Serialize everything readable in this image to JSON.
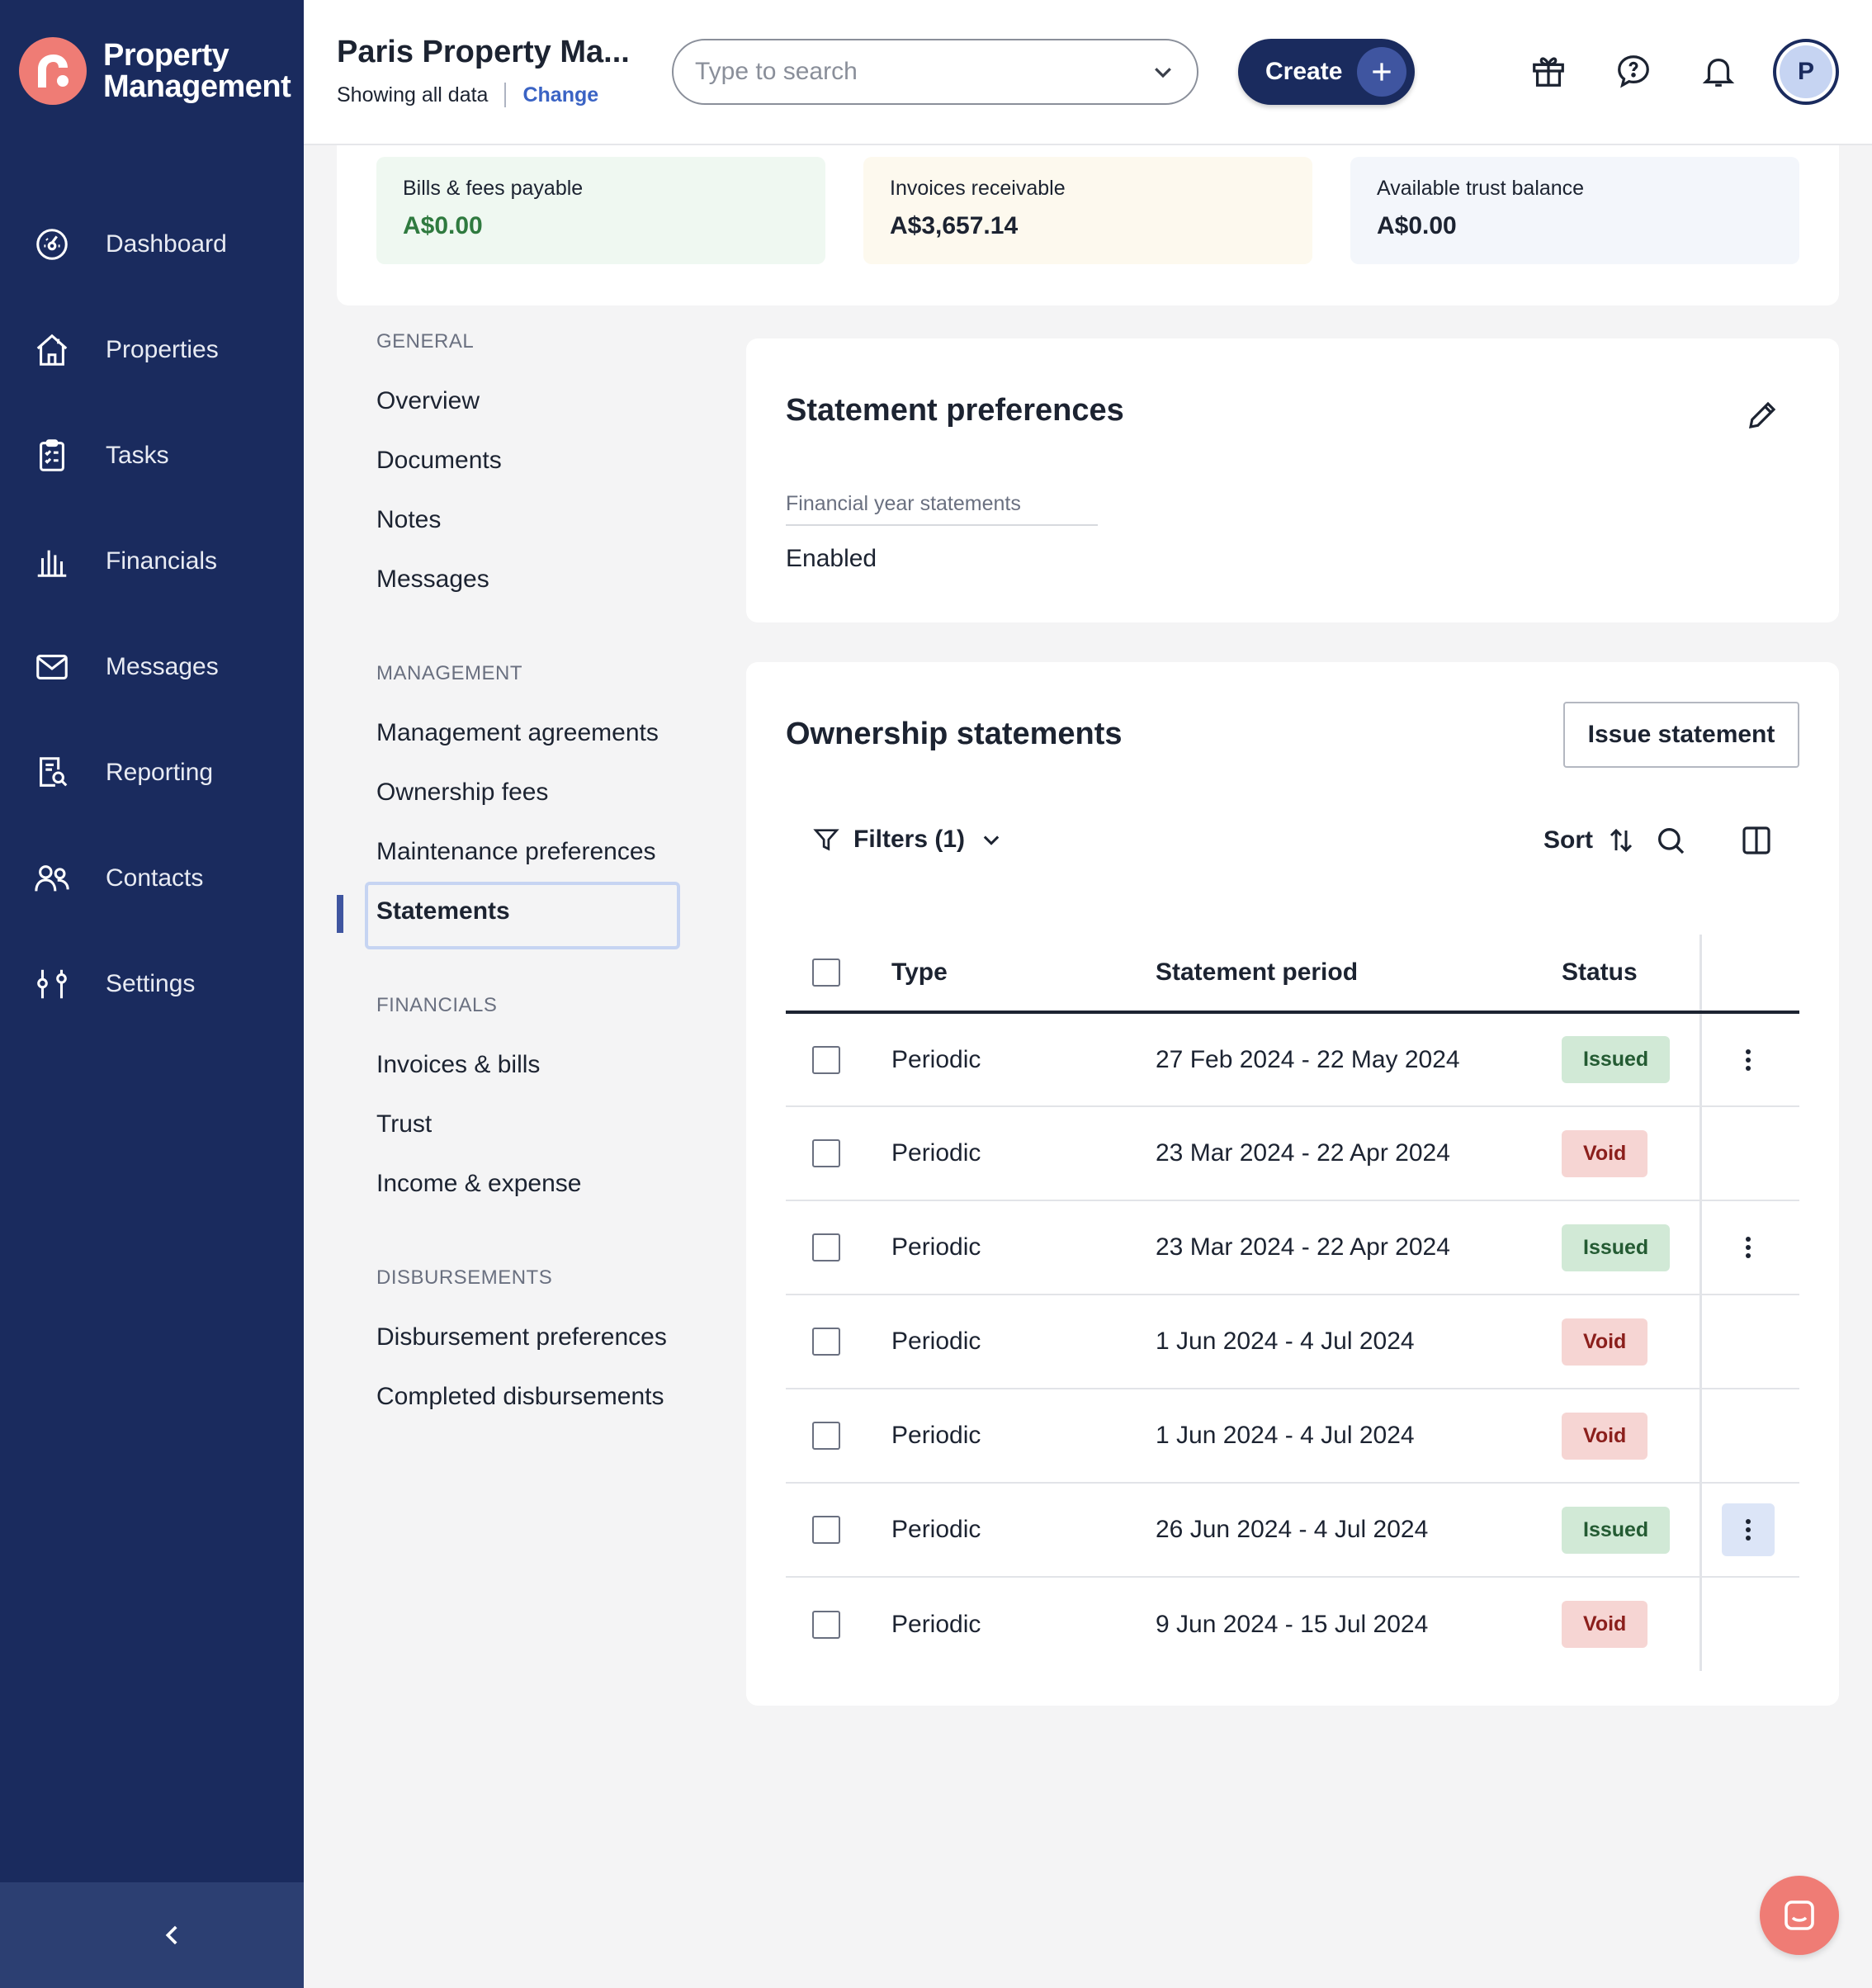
{
  "brand": {
    "name_line1": "Property",
    "name_line2": "Management",
    "accent": "#ef7c75",
    "sidebar_bg": "#1a2b5e"
  },
  "sidebar": {
    "items": [
      {
        "label": "Dashboard",
        "icon": "dashboard-icon"
      },
      {
        "label": "Properties",
        "icon": "house-icon"
      },
      {
        "label": "Tasks",
        "icon": "clipboard-icon"
      },
      {
        "label": "Financials",
        "icon": "bank-icon"
      },
      {
        "label": "Messages",
        "icon": "envelope-icon"
      },
      {
        "label": "Reporting",
        "icon": "report-search-icon"
      },
      {
        "label": "Contacts",
        "icon": "people-icon"
      },
      {
        "label": "Settings",
        "icon": "sliders-icon"
      }
    ],
    "collapse_icon": "chevron-left-icon"
  },
  "header": {
    "title": "Paris Property Ma...",
    "subtitle": "Showing all data",
    "change_link": "Change",
    "search_placeholder": "Type to search",
    "create_label": "Create",
    "avatar_initial": "P",
    "icons": [
      "gift-icon",
      "help-icon",
      "bell-icon"
    ]
  },
  "balances": [
    {
      "label": "Bills & fees payable",
      "value": "A$0.00",
      "bg": "#eff8f1",
      "color": "#2f7a3f"
    },
    {
      "label": "Invoices receivable",
      "value": "A$3,657.14",
      "bg": "#fdf9ee",
      "color": "#1c2331"
    },
    {
      "label": "Available trust balance",
      "value": "A$0.00",
      "bg": "#f3f6fb",
      "color": "#1c2331"
    }
  ],
  "subnav": {
    "general": {
      "heading": "GENERAL",
      "items": [
        "Overview",
        "Documents",
        "Notes",
        "Messages"
      ]
    },
    "management": {
      "heading": "MANAGEMENT",
      "items": [
        "Management agreements",
        "Ownership fees",
        "Maintenance preferences",
        "Statements"
      ]
    },
    "financials": {
      "heading": "FINANCIALS",
      "items": [
        "Invoices & bills",
        "Trust",
        "Income & expense"
      ]
    },
    "disbursements": {
      "heading": "DISBURSEMENTS",
      "items": [
        "Disbursement preferences",
        "Completed disbursements"
      ]
    },
    "active": "Statements"
  },
  "statement_preferences": {
    "title": "Statement preferences",
    "field_label": "Financial year statements",
    "field_value": "Enabled"
  },
  "ownership_statements": {
    "title": "Ownership statements",
    "issue_button": "Issue statement",
    "filters_label": "Filters (1)",
    "sort_label": "Sort",
    "columns": [
      "Type",
      "Statement period",
      "Status"
    ],
    "rows": [
      {
        "type": "Periodic",
        "period": "27 Feb 2024 - 22 May 2024",
        "status": "Issued",
        "has_menu": true,
        "menu_highlight": false
      },
      {
        "type": "Periodic",
        "period": "23 Mar 2024 - 22 Apr 2024",
        "status": "Void",
        "has_menu": false,
        "menu_highlight": false
      },
      {
        "type": "Periodic",
        "period": "23 Mar 2024 - 22 Apr 2024",
        "status": "Issued",
        "has_menu": true,
        "menu_highlight": false
      },
      {
        "type": "Periodic",
        "period": "1 Jun 2024 - 4 Jul 2024",
        "status": "Void",
        "has_menu": false,
        "menu_highlight": false
      },
      {
        "type": "Periodic",
        "period": "1 Jun 2024 - 4 Jul 2024",
        "status": "Void",
        "has_menu": false,
        "menu_highlight": false
      },
      {
        "type": "Periodic",
        "period": "26 Jun 2024 - 4 Jul 2024",
        "status": "Issued",
        "has_menu": true,
        "menu_highlight": true
      },
      {
        "type": "Periodic",
        "period": "9 Jun 2024 - 15 Jul 2024",
        "status": "Void",
        "has_menu": false,
        "menu_highlight": false
      }
    ]
  }
}
